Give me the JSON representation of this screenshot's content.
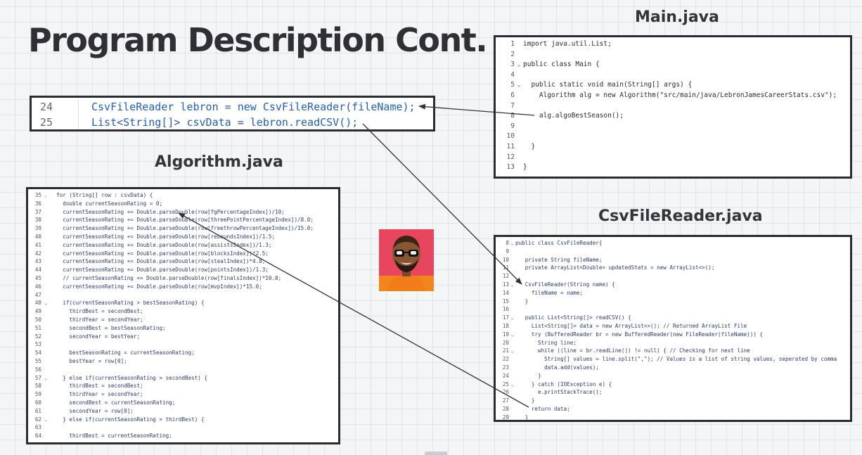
{
  "slide": {
    "title": "Program Description Cont.",
    "captions": {
      "main": "Main.java",
      "algorithm": "Algorithm.java",
      "csv": "CsvFileReader.java"
    }
  },
  "snippet": [
    {
      "ln": "24",
      "code": "CsvFileReader lebron = new CsvFileReader(fileName);"
    },
    {
      "ln": "25",
      "code": "List<String[]> csvData = lebron.readCSV();"
    }
  ],
  "main_code": [
    {
      "ln": "1",
      "fold": "",
      "code": "import java.util.List;"
    },
    {
      "ln": "2",
      "fold": "",
      "code": ""
    },
    {
      "ln": "3",
      "fold": "⌄",
      "code": "public class Main {"
    },
    {
      "ln": "4",
      "fold": "",
      "code": ""
    },
    {
      "ln": "5",
      "fold": "⌄",
      "code": "  public static void main(String[] args) {"
    },
    {
      "ln": "6",
      "fold": "",
      "code": "    Algorithm alg = new Algorithm(\"src/main/java/LebronJamesCareerStats.csv\");"
    },
    {
      "ln": "7",
      "fold": "",
      "code": ""
    },
    {
      "ln": "8",
      "fold": "",
      "code": "    alg.algoBestSeason();"
    },
    {
      "ln": "9",
      "fold": "",
      "code": ""
    },
    {
      "ln": "10",
      "fold": "",
      "code": ""
    },
    {
      "ln": "11",
      "fold": "",
      "code": "  }"
    },
    {
      "ln": "12",
      "fold": "",
      "code": ""
    },
    {
      "ln": "13",
      "fold": "",
      "code": "}"
    }
  ],
  "algo_code": [
    {
      "ln": "35",
      "fold": "⌄",
      "code": "  for (String[] row : csvData) {"
    },
    {
      "ln": "36",
      "fold": "",
      "code": "    double currentSeasonRating = 0;"
    },
    {
      "ln": "37",
      "fold": "",
      "code": "    currentSeasonRating += Double.parseDouble(row[fgPercentageIndex])/10;"
    },
    {
      "ln": "38",
      "fold": "",
      "code": "    currentSeasonRating += Double.parseDouble(row[threePointPercentageIndex])/8.0;"
    },
    {
      "ln": "39",
      "fold": "",
      "code": "    currentSeasonRating += Double.parseDouble(row[freethrowPercentageIndex])/15.0;"
    },
    {
      "ln": "40",
      "fold": "",
      "code": "    currentSeasonRating += Double.parseDouble(row[reboundsIndex])/1.5;"
    },
    {
      "ln": "41",
      "fold": "",
      "code": "    currentSeasonRating += Double.parseDouble(row[assistsIndex])/1.3;"
    },
    {
      "ln": "42",
      "fold": "",
      "code": "    currentSeasonRating += Double.parseDouble(row[blocksIndex])*2.5;"
    },
    {
      "ln": "43",
      "fold": "",
      "code": "    currentSeasonRating += Double.parseDouble(row[stealIndex])*4.0;"
    },
    {
      "ln": "44",
      "fold": "",
      "code": "    currentSeasonRating += Double.parseDouble(row[pointsIndex])/1.3;"
    },
    {
      "ln": "45",
      "fold": "",
      "code": "    // currentSeasonRating += Double.parseDouble(row[finalsIndex])*10.0;"
    },
    {
      "ln": "46",
      "fold": "",
      "code": "    currentSeasonRating += Double.parseDouble(row[mvpIndex])*15.0;"
    },
    {
      "ln": "47",
      "fold": "",
      "code": ""
    },
    {
      "ln": "48",
      "fold": "⌄",
      "code": "    if(currentSeasonRating > bestSeasonRating) {"
    },
    {
      "ln": "49",
      "fold": "",
      "code": "      thirdBest = secondBest;"
    },
    {
      "ln": "50",
      "fold": "",
      "code": "      thirdYear = secondYear;"
    },
    {
      "ln": "51",
      "fold": "",
      "code": "      secondBest = bestSeasonRating;"
    },
    {
      "ln": "52",
      "fold": "",
      "code": "      secondYear = bestYear;"
    },
    {
      "ln": "53",
      "fold": "",
      "code": ""
    },
    {
      "ln": "54",
      "fold": "",
      "code": "      bestSeasonRating = currentSeasonRating;"
    },
    {
      "ln": "55",
      "fold": "",
      "code": "      bestYear = row[0];"
    },
    {
      "ln": "56",
      "fold": "",
      "code": ""
    },
    {
      "ln": "57",
      "fold": "⌄",
      "code": "    } else if(currentSeasonRating > secondBest) {"
    },
    {
      "ln": "58",
      "fold": "",
      "code": "      thirdBest = secondBest;"
    },
    {
      "ln": "59",
      "fold": "",
      "code": "      thirdYear = secondYear;"
    },
    {
      "ln": "60",
      "fold": "",
      "code": "      secondBest = currentSeasonRating;"
    },
    {
      "ln": "61",
      "fold": "",
      "code": "      secondYear = row[0];"
    },
    {
      "ln": "62",
      "fold": "⌄",
      "code": "    } else if(currentSeasonRating > thirdBest) {"
    },
    {
      "ln": "63",
      "fold": "",
      "code": ""
    },
    {
      "ln": "64",
      "fold": "",
      "code": "      thirdBest = currentSeasonRating;"
    }
  ],
  "csv_code": [
    {
      "ln": "8",
      "fold": "⌄",
      "code": "public class CsvFileReader{"
    },
    {
      "ln": "9",
      "fold": "",
      "code": ""
    },
    {
      "ln": "10",
      "fold": "",
      "code": "   private String fileName;"
    },
    {
      "ln": "11",
      "fold": "",
      "code": "   private ArrayList<Double> updatedStats = new ArrayList<>();"
    },
    {
      "ln": "12",
      "fold": "",
      "code": ""
    },
    {
      "ln": "13",
      "fold": "⌄",
      "code": "   CsvFileReader(String name) {"
    },
    {
      "ln": "14",
      "fold": "",
      "code": "     fileName = name;"
    },
    {
      "ln": "15",
      "fold": "",
      "code": "   }"
    },
    {
      "ln": "16",
      "fold": "",
      "code": ""
    },
    {
      "ln": "17",
      "fold": "⌄",
      "code": "   public List<String[]> readCSV() {"
    },
    {
      "ln": "18",
      "fold": "",
      "code": "     List<String[]> data = new ArrayList<>(); // Returned ArrayList File"
    },
    {
      "ln": "19",
      "fold": "⌄",
      "code": "     try (BufferedReader br = new BufferedReader(new FileReader(fileName))) {"
    },
    {
      "ln": "20",
      "fold": "",
      "code": "       String line;"
    },
    {
      "ln": "21",
      "fold": "⌄",
      "code": "       while ((line = br.readLine()) != null) { // Checking for next line"
    },
    {
      "ln": "22",
      "fold": "",
      "code": "         String[] values = line.split(\",\"); // Values is a list of string values, seperated by comma"
    },
    {
      "ln": "23",
      "fold": "",
      "code": "         data.add(values);"
    },
    {
      "ln": "24",
      "fold": "",
      "code": "       }"
    },
    {
      "ln": "25",
      "fold": "⌄",
      "code": "     } catch (IOException e) {"
    },
    {
      "ln": "26",
      "fold": "",
      "code": "       e.printStackTrace();"
    },
    {
      "ln": "27",
      "fold": "",
      "code": "     }"
    },
    {
      "ln": "28",
      "fold": "",
      "code": "     return data;"
    },
    {
      "ln": "29",
      "fold": "",
      "code": "   }"
    }
  ],
  "colors": {
    "title": "#2f2f35",
    "border": "#2b2b30",
    "keyword": "#1f5fbf",
    "arrow": "#333333",
    "avatar_bg": "#e8455e"
  },
  "icons": {
    "fold": "chevron-down-icon",
    "avatar": "person-photo-avatar"
  }
}
